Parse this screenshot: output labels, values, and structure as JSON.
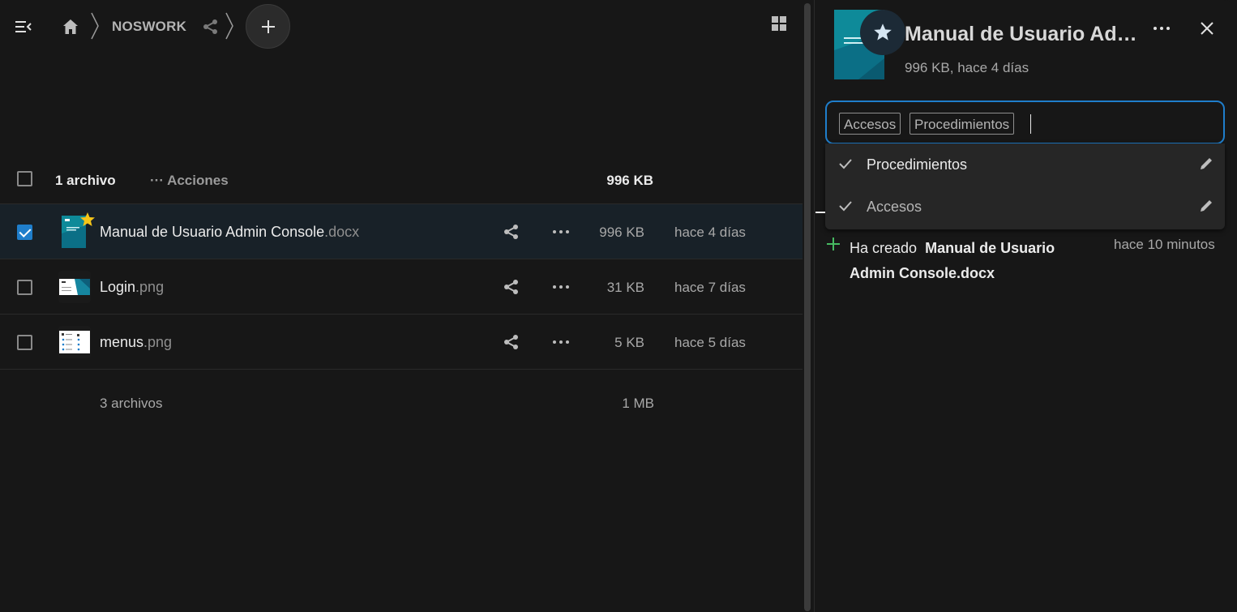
{
  "breadcrumb": {
    "folder": "NOSWORK"
  },
  "list": {
    "header": {
      "count": "1 archivo",
      "actions": "Acciones",
      "size": "996 KB"
    },
    "files": [
      {
        "name": "Manual de Usuario Admin Console",
        "ext": ".docx",
        "size": "996 KB",
        "date": "hace 4 días",
        "selected": true,
        "favorite": true
      },
      {
        "name": "Login",
        "ext": ".png",
        "size": "31 KB",
        "date": "hace 7 días",
        "selected": false,
        "favorite": false
      },
      {
        "name": "menus",
        "ext": ".png",
        "size": "5 KB",
        "date": "hace 5 días",
        "selected": false,
        "favorite": false
      }
    ],
    "summary": {
      "count": "3 archivos",
      "size": "1 MB"
    }
  },
  "sidebar": {
    "title": "Manual de Usuario Admin Console.docx",
    "subtitle": "996 KB, hace 4 días",
    "tags": [
      "Accesos",
      "Procedimientos"
    ],
    "dropdown": [
      {
        "label": "Procedimientos",
        "color": "#ebebeb"
      },
      {
        "label": "Accesos",
        "color": "#b4b4b4"
      }
    ],
    "activity": {
      "prefix": "Ha creado",
      "file": "Manual de Usuario Admin Console.docx",
      "time": "hace 10 minutos"
    }
  },
  "colors": {
    "accent": "#1f7ecb",
    "favorite": "#f5c518",
    "activity_plus": "#46ba61"
  }
}
